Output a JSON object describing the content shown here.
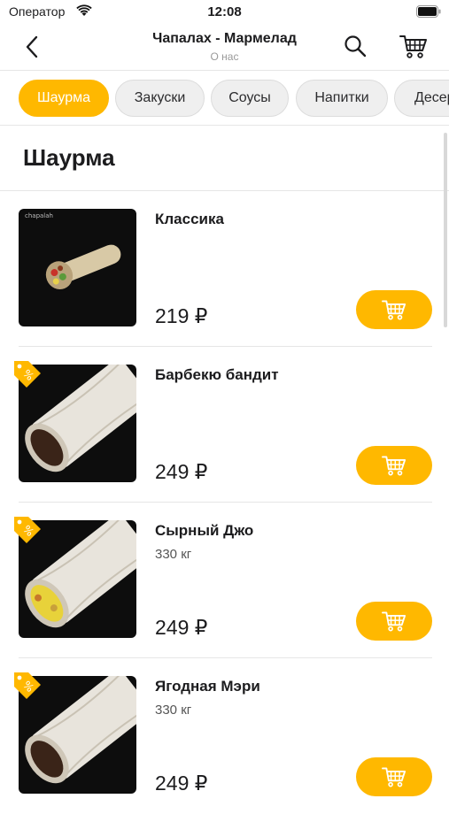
{
  "status_bar": {
    "carrier": "Оператор",
    "time": "12:08"
  },
  "nav": {
    "title": "Чапалах - Мармелад",
    "subtitle": "О нас"
  },
  "tabs": [
    {
      "label": "Шаурма",
      "active": true
    },
    {
      "label": "Закуски",
      "active": false
    },
    {
      "label": "Соусы",
      "active": false
    },
    {
      "label": "Напитки",
      "active": false
    },
    {
      "label": "Десерты",
      "active": false
    }
  ],
  "section": {
    "title": "Шаурма"
  },
  "products": [
    {
      "name": "Классика",
      "weight": "",
      "price": "219 ₽",
      "discount": false,
      "image_label": "chapalah",
      "icon": "cart-icon"
    },
    {
      "name": "Барбекю бандит",
      "weight": "",
      "price": "249 ₽",
      "discount": true,
      "icon": "cart-icon"
    },
    {
      "name": "Сырный Джо",
      "weight": "330 кг",
      "price": "249 ₽",
      "discount": true,
      "icon": "cart-icon"
    },
    {
      "name": "Ягодная Мэри",
      "weight": "330 кг",
      "price": "249 ₽",
      "discount": true,
      "icon": "cart-icon"
    }
  ],
  "colors": {
    "accent": "#ffb800",
    "tab_inactive": "#efefef",
    "image_bg": "#0d0d0d"
  }
}
